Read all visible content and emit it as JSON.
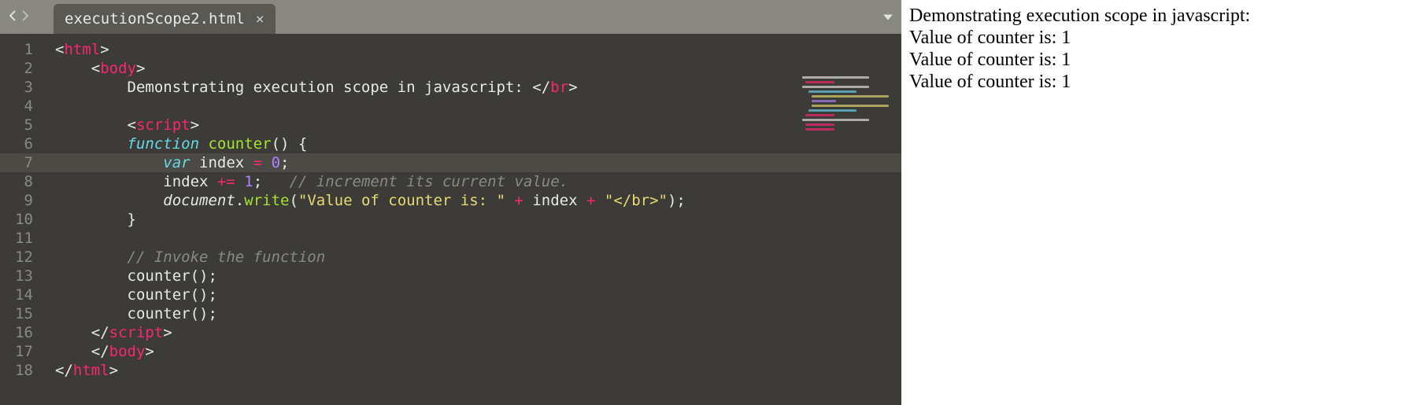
{
  "tab": {
    "filename": "executionScope2.html",
    "close_glyph": "×"
  },
  "editor": {
    "highlighted_line": 7,
    "lines": [
      {
        "n": 1,
        "indent": 0,
        "tokens": [
          {
            "cls": "punct",
            "t": "<"
          },
          {
            "cls": "tagname",
            "t": "html"
          },
          {
            "cls": "punct",
            "t": ">"
          }
        ]
      },
      {
        "n": 2,
        "indent": 1,
        "tokens": [
          {
            "cls": "punct",
            "t": "<"
          },
          {
            "cls": "tagname",
            "t": "body"
          },
          {
            "cls": "punct",
            "t": ">"
          }
        ]
      },
      {
        "n": 3,
        "indent": 2,
        "tokens": [
          {
            "cls": "plain",
            "t": "Demonstrating execution scope in javascript: "
          },
          {
            "cls": "punct",
            "t": "</"
          },
          {
            "cls": "tagname",
            "t": "br"
          },
          {
            "cls": "punct",
            "t": ">"
          }
        ]
      },
      {
        "n": 4,
        "indent": 0,
        "tokens": []
      },
      {
        "n": 5,
        "indent": 2,
        "tokens": [
          {
            "cls": "punct",
            "t": "<"
          },
          {
            "cls": "tagname",
            "t": "script"
          },
          {
            "cls": "punct",
            "t": ">"
          }
        ]
      },
      {
        "n": 6,
        "indent": 2,
        "tokens": [
          {
            "cls": "keyword",
            "t": "function"
          },
          {
            "cls": "plain",
            "t": " "
          },
          {
            "cls": "fn",
            "t": "counter"
          },
          {
            "cls": "punct",
            "t": "() {"
          }
        ]
      },
      {
        "n": 7,
        "indent": 3,
        "tokens": [
          {
            "cls": "storage",
            "t": "var"
          },
          {
            "cls": "plain",
            "t": " index "
          },
          {
            "cls": "op",
            "t": "="
          },
          {
            "cls": "plain",
            "t": " "
          },
          {
            "cls": "num",
            "t": "0"
          },
          {
            "cls": "punct",
            "t": ";"
          }
        ]
      },
      {
        "n": 8,
        "indent": 3,
        "tokens": [
          {
            "cls": "plain",
            "t": "index "
          },
          {
            "cls": "op",
            "t": "+="
          },
          {
            "cls": "plain",
            "t": " "
          },
          {
            "cls": "num",
            "t": "1"
          },
          {
            "cls": "punct",
            "t": ";   "
          },
          {
            "cls": "comment",
            "t": "// increment its current value."
          }
        ]
      },
      {
        "n": 9,
        "indent": 3,
        "tokens": [
          {
            "cls": "objname",
            "t": "document"
          },
          {
            "cls": "punct",
            "t": "."
          },
          {
            "cls": "fn",
            "t": "write"
          },
          {
            "cls": "punct",
            "t": "("
          },
          {
            "cls": "str",
            "t": "\"Value of counter is: \""
          },
          {
            "cls": "plain",
            "t": " "
          },
          {
            "cls": "op",
            "t": "+"
          },
          {
            "cls": "plain",
            "t": " index "
          },
          {
            "cls": "op",
            "t": "+"
          },
          {
            "cls": "plain",
            "t": " "
          },
          {
            "cls": "str",
            "t": "\"</br>\""
          },
          {
            "cls": "punct",
            "t": ");"
          }
        ]
      },
      {
        "n": 10,
        "indent": 2,
        "tokens": [
          {
            "cls": "punct",
            "t": "}"
          }
        ]
      },
      {
        "n": 11,
        "indent": 0,
        "tokens": []
      },
      {
        "n": 12,
        "indent": 2,
        "tokens": [
          {
            "cls": "comment",
            "t": "// Invoke the function"
          }
        ]
      },
      {
        "n": 13,
        "indent": 2,
        "tokens": [
          {
            "cls": "plain",
            "t": "counter();"
          }
        ]
      },
      {
        "n": 14,
        "indent": 2,
        "tokens": [
          {
            "cls": "plain",
            "t": "counter();"
          }
        ]
      },
      {
        "n": 15,
        "indent": 2,
        "tokens": [
          {
            "cls": "plain",
            "t": "counter();"
          }
        ]
      },
      {
        "n": 16,
        "indent": 1,
        "tokens": [
          {
            "cls": "punct",
            "t": "</"
          },
          {
            "cls": "tagname",
            "t": "script"
          },
          {
            "cls": "punct",
            "t": ">"
          }
        ]
      },
      {
        "n": 17,
        "indent": 1,
        "tokens": [
          {
            "cls": "punct",
            "t": "</"
          },
          {
            "cls": "tagname",
            "t": "body"
          },
          {
            "cls": "punct",
            "t": ">"
          }
        ]
      },
      {
        "n": 18,
        "indent": 0,
        "tokens": [
          {
            "cls": "punct",
            "t": "</"
          },
          {
            "cls": "tagname",
            "t": "html"
          },
          {
            "cls": "punct",
            "t": ">"
          }
        ]
      }
    ]
  },
  "output": {
    "lines": [
      "Demonstrating execution scope in javascript:",
      "Value of counter is: 1",
      "Value of counter is: 1",
      "Value of counter is: 1"
    ]
  }
}
